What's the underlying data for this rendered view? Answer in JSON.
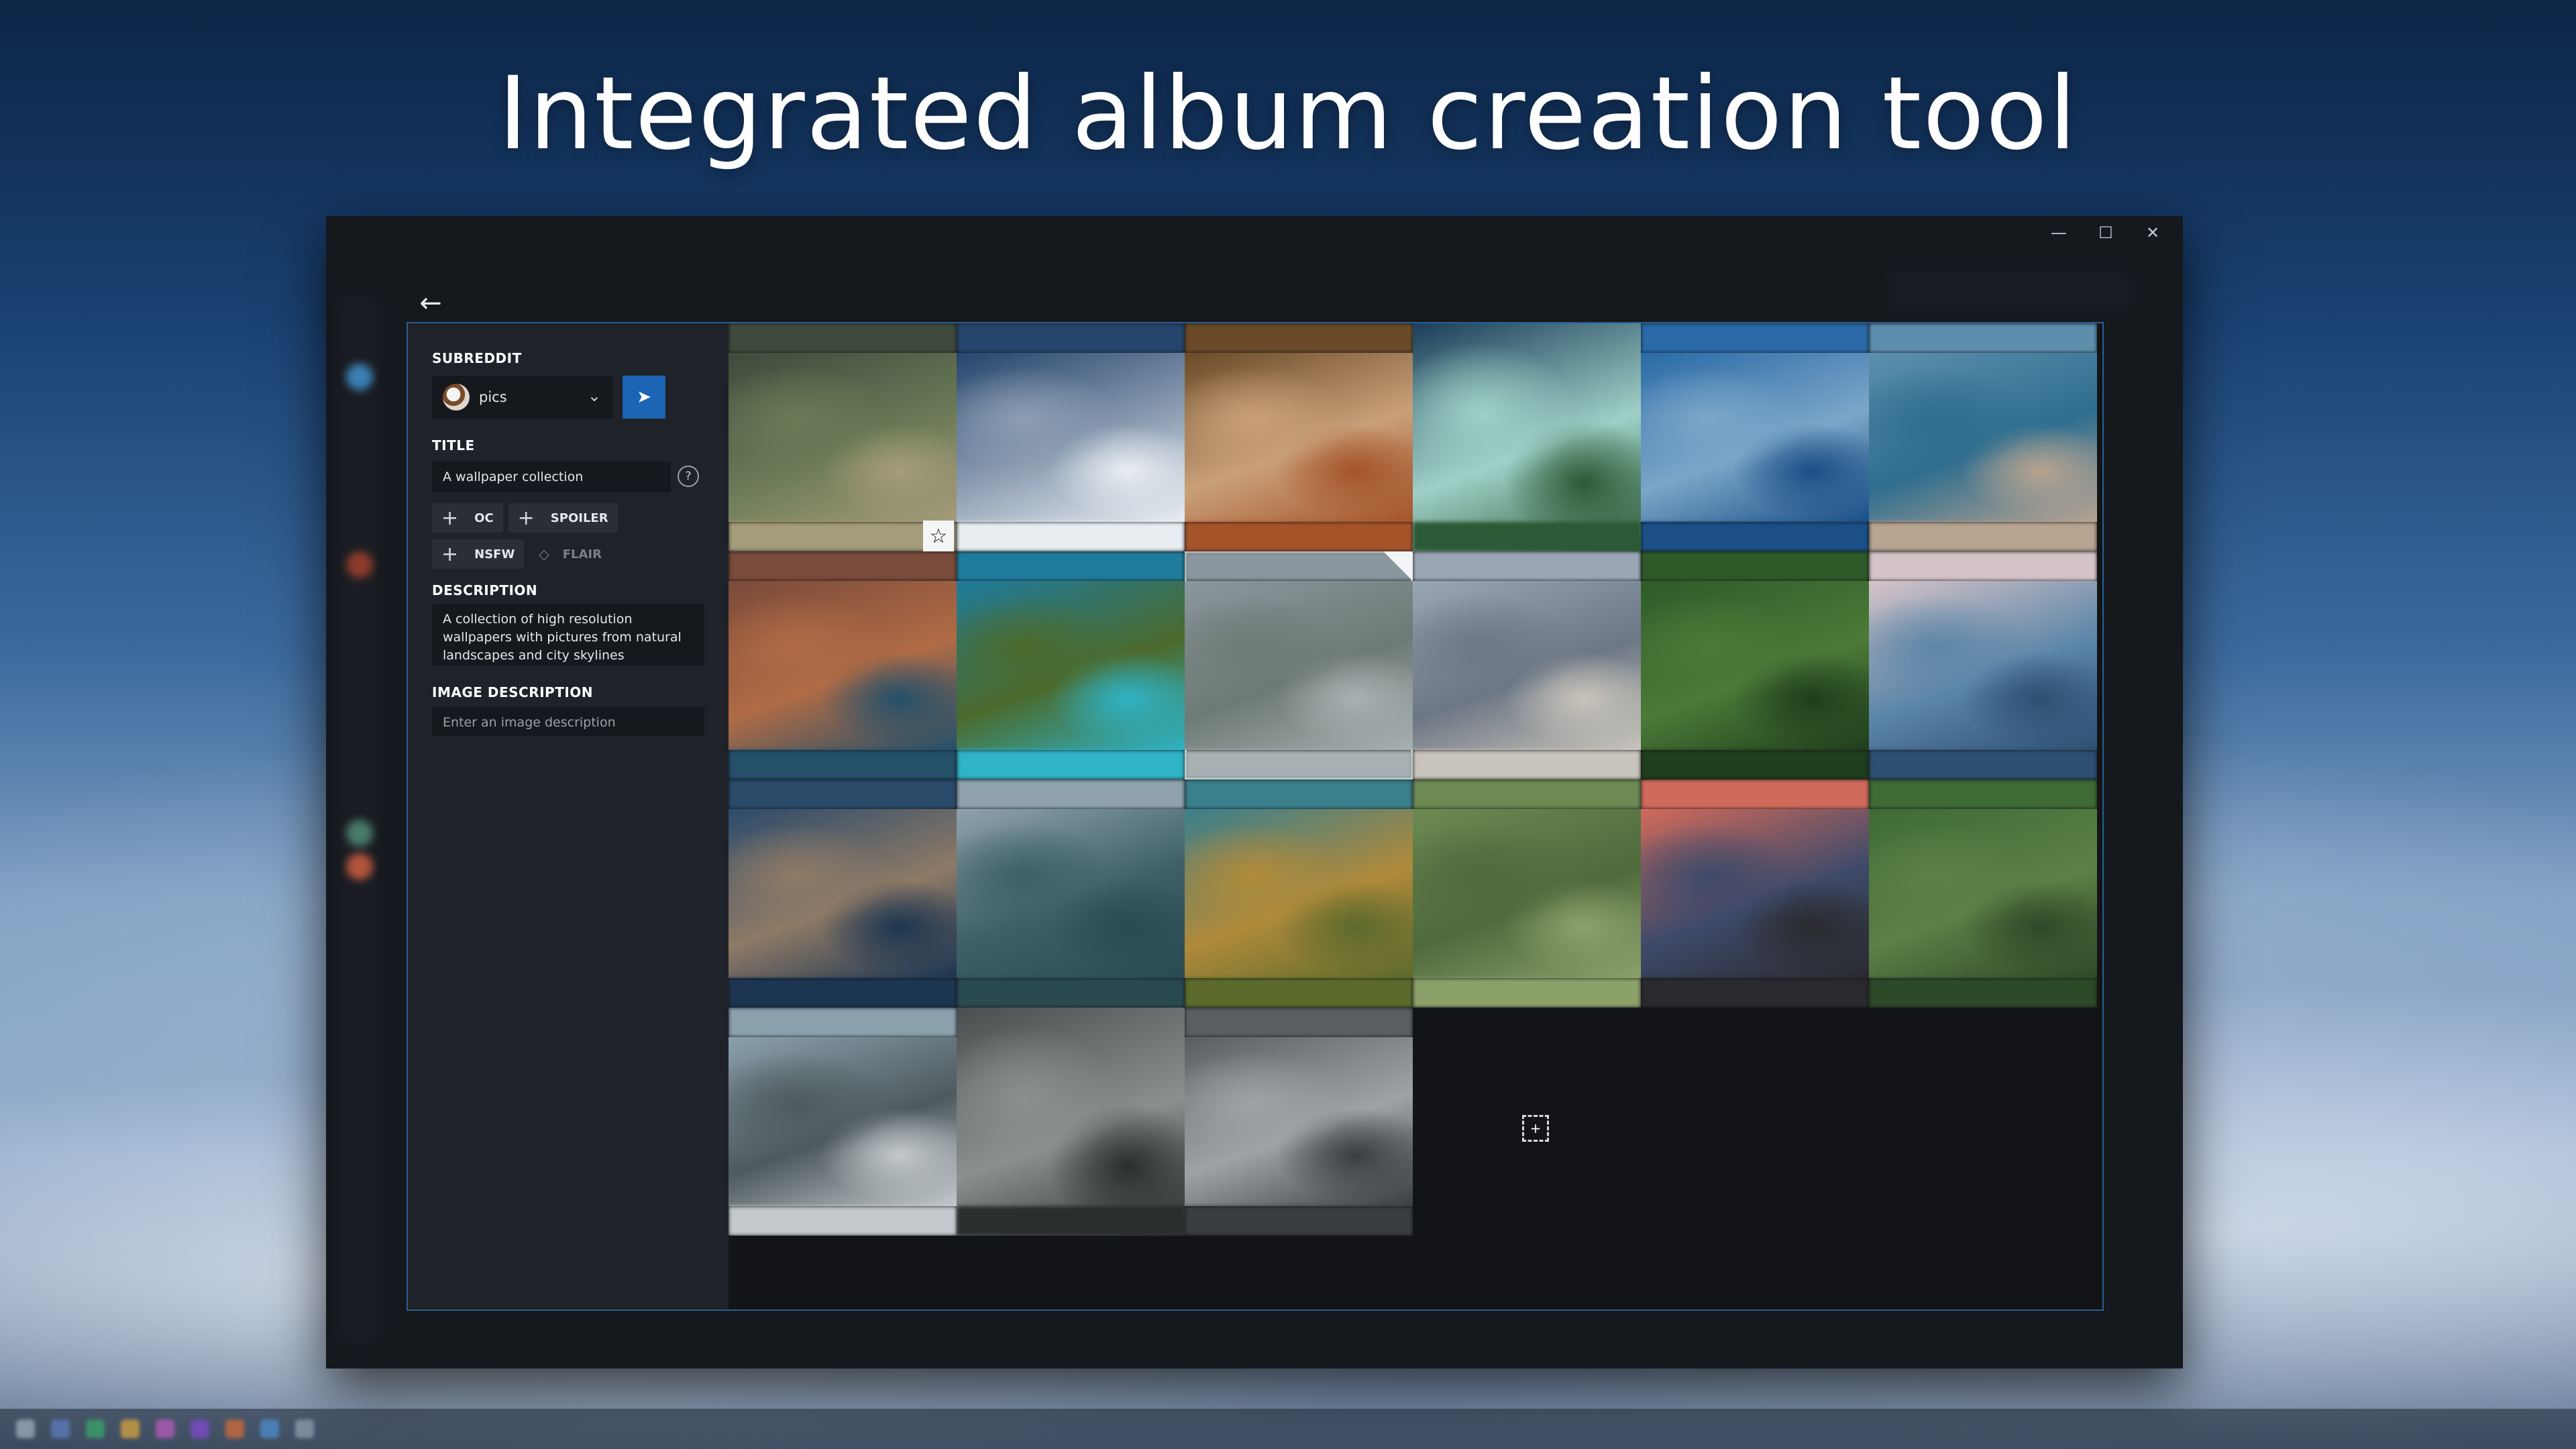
{
  "headline": "Integrated album creation tool",
  "window": {
    "controls": [
      "—",
      "☐",
      "✕"
    ]
  },
  "form": {
    "back_icon": "←",
    "subreddit_label": "SUBREDDIT",
    "subreddit_value": "pics",
    "subreddit_chevron": "⌄",
    "send_icon": "➤",
    "title_label": "TITLE",
    "title_value": "A wallpaper collection",
    "help_icon": "?",
    "tags": {
      "plus": "+",
      "oc": "OC",
      "spoiler": "SPOILER",
      "nsfw": "NSFW",
      "flair": "FLAIR",
      "flair_icon": "◇"
    },
    "description_label": "DESCRIPTION",
    "description_value": "A collection of high resolution wallpapers with pictures from natural landscapes and city skylines",
    "image_description_label": "IMAGE DESCRIPTION",
    "image_description_placeholder": "Enter an image description"
  },
  "grid": {
    "star_icon": "☆",
    "add_icon": "+",
    "images": [
      {
        "name": "river-city-aerial",
        "colors": [
          "#3f4a3c",
          "#6b7a57",
          "#a59c7a"
        ]
      },
      {
        "name": "snowy-mountains",
        "colors": [
          "#25456c",
          "#8d9eb3",
          "#e8edf2"
        ]
      },
      {
        "name": "city-autumn-trees",
        "colors": [
          "#6a4a28",
          "#c9a079",
          "#a5542a"
        ]
      },
      {
        "name": "atoll-island",
        "colors": [
          "#1b3e5a",
          "#9fd0c7",
          "#2c5a36"
        ]
      },
      {
        "name": "coastal-city-blue",
        "colors": [
          "#2a6aa6",
          "#7ba6c8",
          "#1b4f86"
        ]
      },
      {
        "name": "coastline-city",
        "colors": [
          "#5d8fad",
          "#2f6e8f",
          "#b7a491"
        ]
      },
      {
        "name": "red-cliffs-coast",
        "colors": [
          "#7a4a3a",
          "#b06b45",
          "#24506a"
        ]
      },
      {
        "name": "tropical-cove",
        "colors": [
          "#1f7c9c",
          "#4b6a2c",
          "#2fb3c6"
        ]
      },
      {
        "name": "city-river-haze",
        "colors": [
          "#8b979e",
          "#6e7a74",
          "#a7b1b3"
        ]
      },
      {
        "name": "bridge-river-city",
        "colors": [
          "#9aa6b3",
          "#6c7785",
          "#c9c4bb"
        ]
      },
      {
        "name": "winding-forest-road",
        "colors": [
          "#2e5a29",
          "#4c7a38",
          "#1f3e1c"
        ]
      },
      {
        "name": "sunset-clouds",
        "colors": [
          "#d5c3c8",
          "#5c86a8",
          "#2d4f72"
        ]
      },
      {
        "name": "mountain-ridges",
        "colors": [
          "#2b4b6b",
          "#8e7a66",
          "#1c3551"
        ]
      },
      {
        "name": "sea-islands",
        "colors": [
          "#8fa2ad",
          "#3d5f66",
          "#2a4a52"
        ]
      },
      {
        "name": "autumn-lake",
        "colors": [
          "#3a7f8c",
          "#b08a3a",
          "#5c6a2c"
        ]
      },
      {
        "name": "meandering-stream",
        "colors": [
          "#6c8a52",
          "#4f6a3c",
          "#8ca06a"
        ]
      },
      {
        "name": "city-sunset-sky",
        "colors": [
          "#d06a5a",
          "#3e4a6a",
          "#2a2a2e"
        ]
      },
      {
        "name": "green-valley-road",
        "colors": [
          "#3e6a34",
          "#5c8046",
          "#2d4a28"
        ]
      },
      {
        "name": "construction-site",
        "colors": [
          "#8aa0ad",
          "#4e5a5e",
          "#c3c9cc"
        ]
      },
      {
        "name": "domed-stadium",
        "colors": [
          "#4a4e4e",
          "#8a9090",
          "#2a2e2e"
        ]
      },
      {
        "name": "dense-city-grid",
        "colors": [
          "#5a5e60",
          "#9ea4a6",
          "#3a3e40"
        ]
      }
    ]
  }
}
